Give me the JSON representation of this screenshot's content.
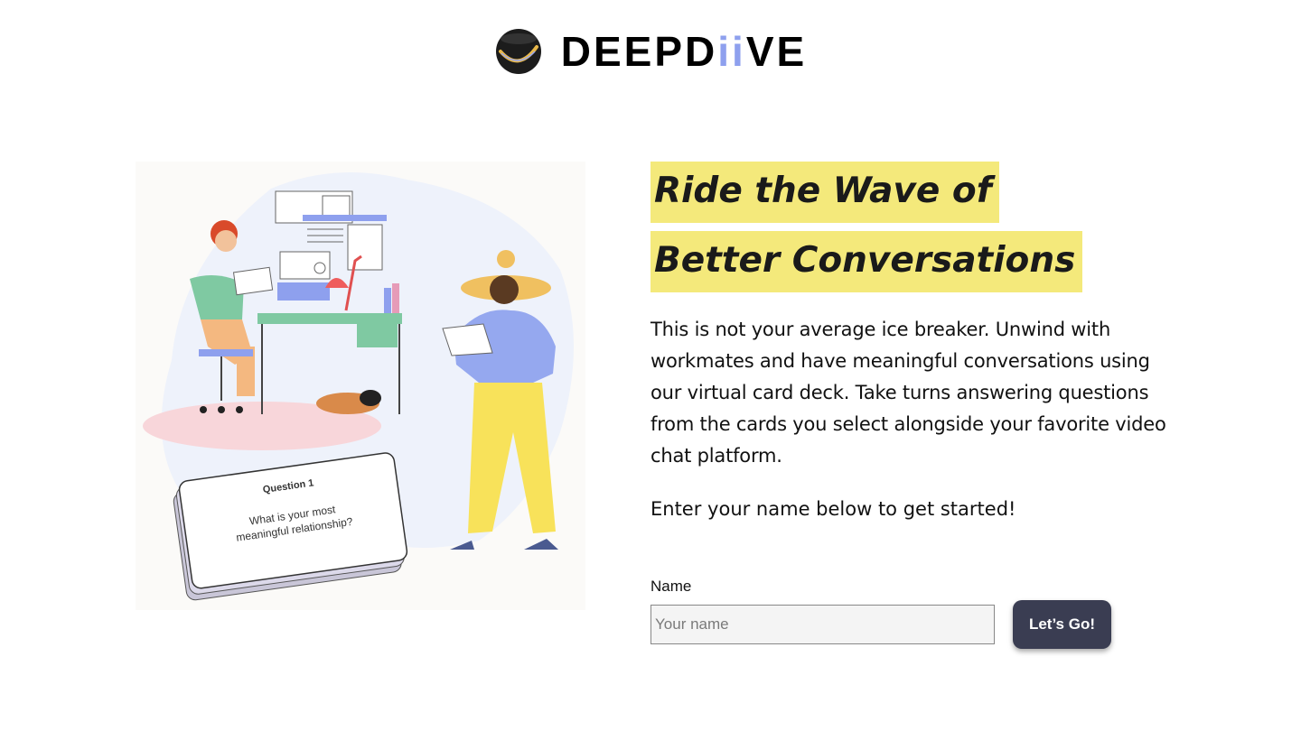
{
  "brand": {
    "name_part1": "DEEPD",
    "name_accent": "ii",
    "name_part2": "VE",
    "accent_color": "#8ea0ee"
  },
  "illustration": {
    "card_title": "Question 1",
    "card_question_line1": "What is your most",
    "card_question_line2": "meaningful relationship?"
  },
  "hero": {
    "headline_line1": "Ride the Wave of",
    "headline_line2": "Better Conversations",
    "highlight_color": "#f4e97b",
    "description": "This is not your average ice breaker. Unwind with workmates and have meaningful conversations using our virtual card deck. Take turns answering questions from the cards you select alongside your favorite video chat platform.",
    "cta_text": "Enter your name below to get started!"
  },
  "form": {
    "name_label": "Name",
    "name_placeholder": "Your name",
    "name_value": "",
    "submit_label": "Let’s Go!",
    "button_color": "#3a3d52"
  }
}
